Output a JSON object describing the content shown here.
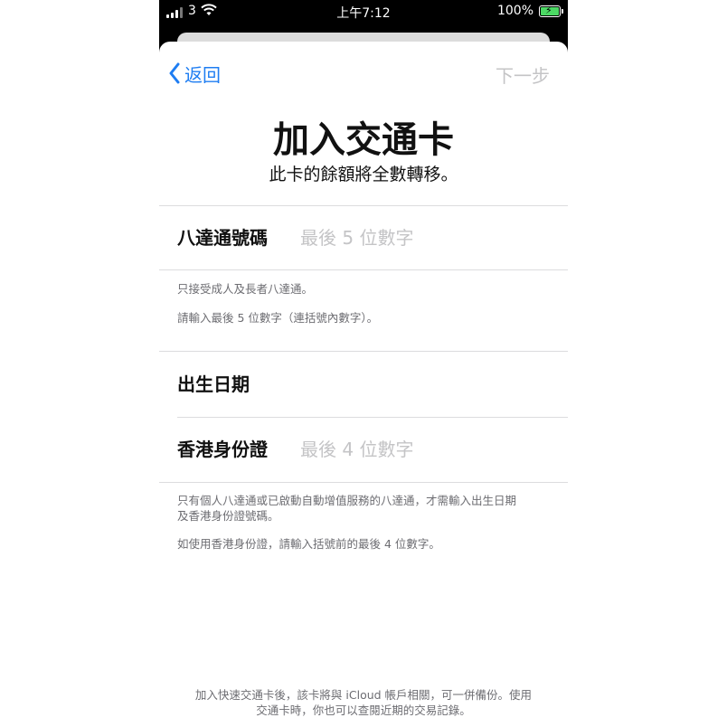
{
  "status_bar": {
    "carrier": "3",
    "time": "上午7:12",
    "battery_percent": "100%"
  },
  "nav": {
    "back_label": "返回",
    "next_label": "下一步"
  },
  "header": {
    "title": "加入交通卡",
    "subtitle": "此卡的餘額將全數轉移。"
  },
  "card_section": {
    "label": "八達通號碼",
    "placeholder": "最後 5 位數字",
    "note_1": "只接受成人及長者八達通。",
    "note_2": "請輸入最後 5 位數字（連括號內數字）。"
  },
  "identity_section": {
    "dob_label": "出生日期",
    "hkid_label": "香港身份證",
    "hkid_placeholder": "最後 4 位數字",
    "note_1_line1": "只有個人八達通或已啟動自動增值服務的八達通，才需輸入出生日期",
    "note_1_line2": "及香港身份證號碼。",
    "note_2": "如使用香港身份證，請輸入括號前的最後 4 位數字。"
  },
  "footer": {
    "line1": "加入快速交通卡後，該卡將與 iCloud 帳戶相關，可一併備份。使用",
    "line2": "交通卡時，你也可以查閱近期的交易記錄。"
  },
  "colors": {
    "accent": "#1e7df2",
    "disabled": "#c4c4c6",
    "battery": "#4cd964"
  },
  "icons": [
    "signal-icon",
    "wifi-icon",
    "battery-icon",
    "chevron-left-icon"
  ]
}
